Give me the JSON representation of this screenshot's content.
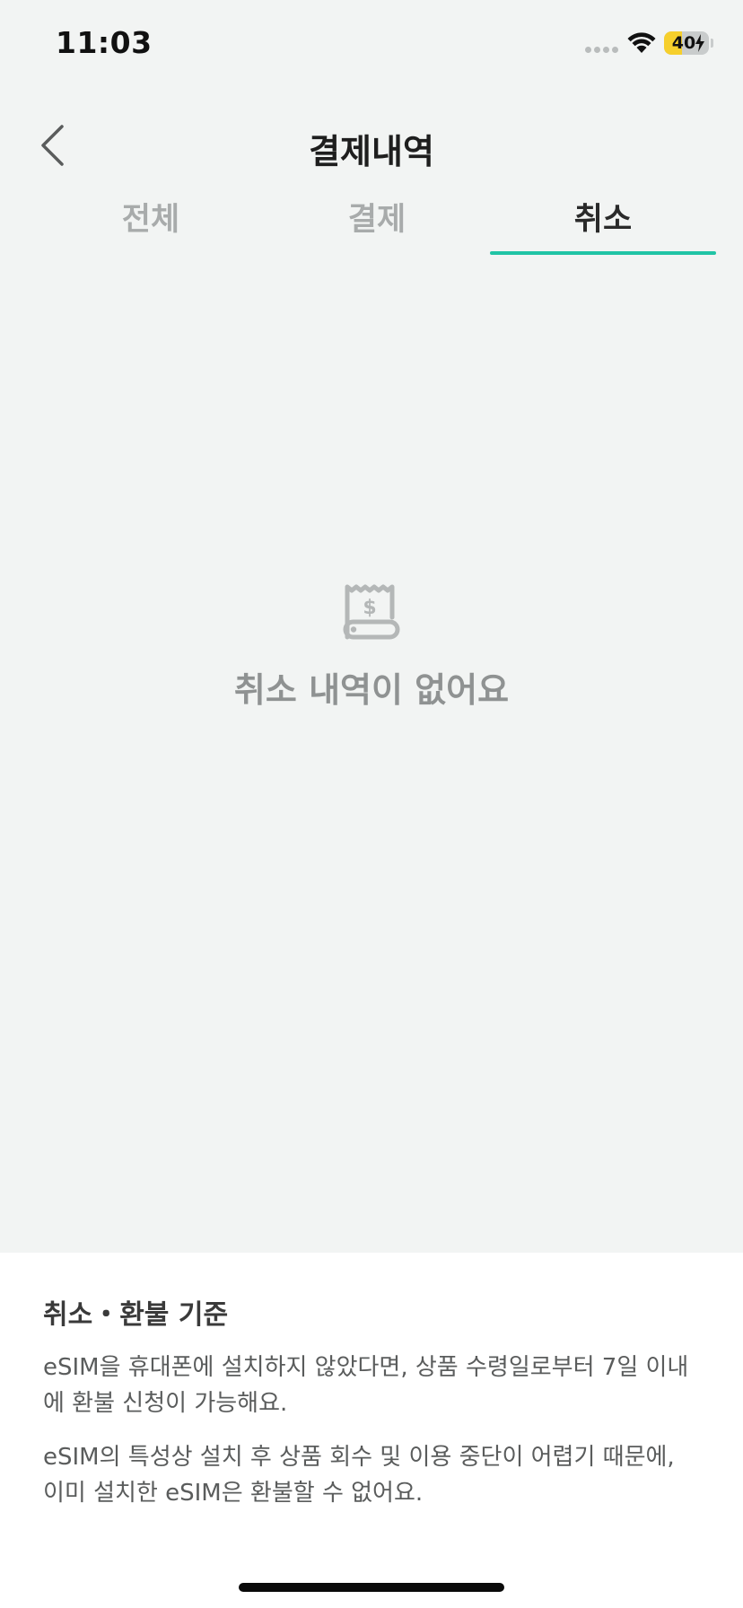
{
  "status_bar": {
    "time": "11:03",
    "battery_level": "40",
    "battery_fill_percent": 40
  },
  "header": {
    "title": "결제내역",
    "back_icon": "chevron-left-icon"
  },
  "tabs": [
    {
      "label": "전체",
      "active": false
    },
    {
      "label": "결제",
      "active": false
    },
    {
      "label": "취소",
      "active": true
    }
  ],
  "empty_state": {
    "icon": "receipt-icon",
    "message": "취소 내역이 없어요"
  },
  "refund_policy": {
    "title": "취소・환불 기준",
    "paragraphs": [
      "eSIM을 휴대폰에 설치하지 않았다면, 상품 수령일로부터 7일 이내에 환불 신청이 가능해요.",
      "eSIM의 특성상 설치 후 상품 회수 및 이용 중단이 어렵기 때문에, 이미 설치한 eSIM은 환불할 수 없어요."
    ]
  },
  "colors": {
    "accent": "#21c4a5",
    "background": "#f2f4f3",
    "battery": "#f6cf2c"
  }
}
